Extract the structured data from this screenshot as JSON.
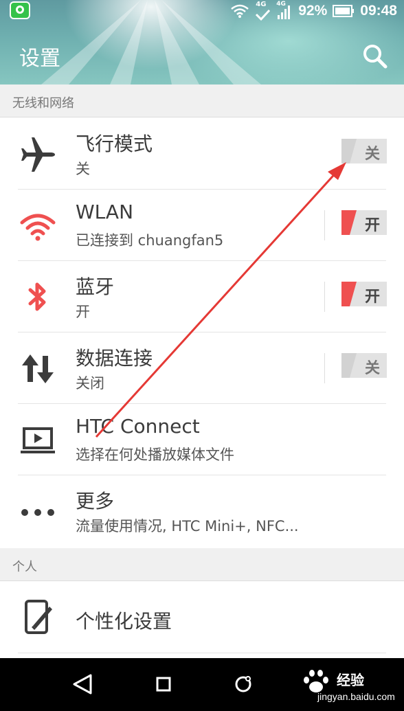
{
  "status_bar": {
    "battery": "92%",
    "time": "09:48",
    "network": "4G",
    "network2": "4G"
  },
  "header": {
    "title": "设置"
  },
  "sections": {
    "wireless": "无线和网络",
    "personal": "个人"
  },
  "rows": [
    {
      "title": "飞行模式",
      "subtitle": "关",
      "toggle": "关",
      "toggle_on": false,
      "icon": "airplane-icon"
    },
    {
      "title": "WLAN",
      "subtitle": "已连接到 chuangfan5",
      "toggle": "开",
      "toggle_on": true,
      "icon": "wifi-icon"
    },
    {
      "title": "蓝牙",
      "subtitle": "开",
      "toggle": "开",
      "toggle_on": true,
      "icon": "bluetooth-icon"
    },
    {
      "title": "数据连接",
      "subtitle": "关闭",
      "toggle": "关",
      "toggle_on": false,
      "icon": "data-transfer-icon"
    },
    {
      "title": "HTC Connect",
      "subtitle": "选择在何处播放媒体文件",
      "icon": "cast-screen-icon"
    },
    {
      "title": "更多",
      "subtitle": "流量使用情况, HTC Mini+, NFC...",
      "icon": "more-dots-icon"
    }
  ],
  "personal_rows": [
    {
      "title": "个性化设置",
      "icon": "personalize-icon"
    }
  ],
  "watermark": {
    "text": "经验",
    "url": "jingyan.baidu.com"
  },
  "colors": {
    "accent_red": "#ef5050",
    "icon_gray": "#3c3c3c",
    "section_bg": "#f0f0f0"
  }
}
